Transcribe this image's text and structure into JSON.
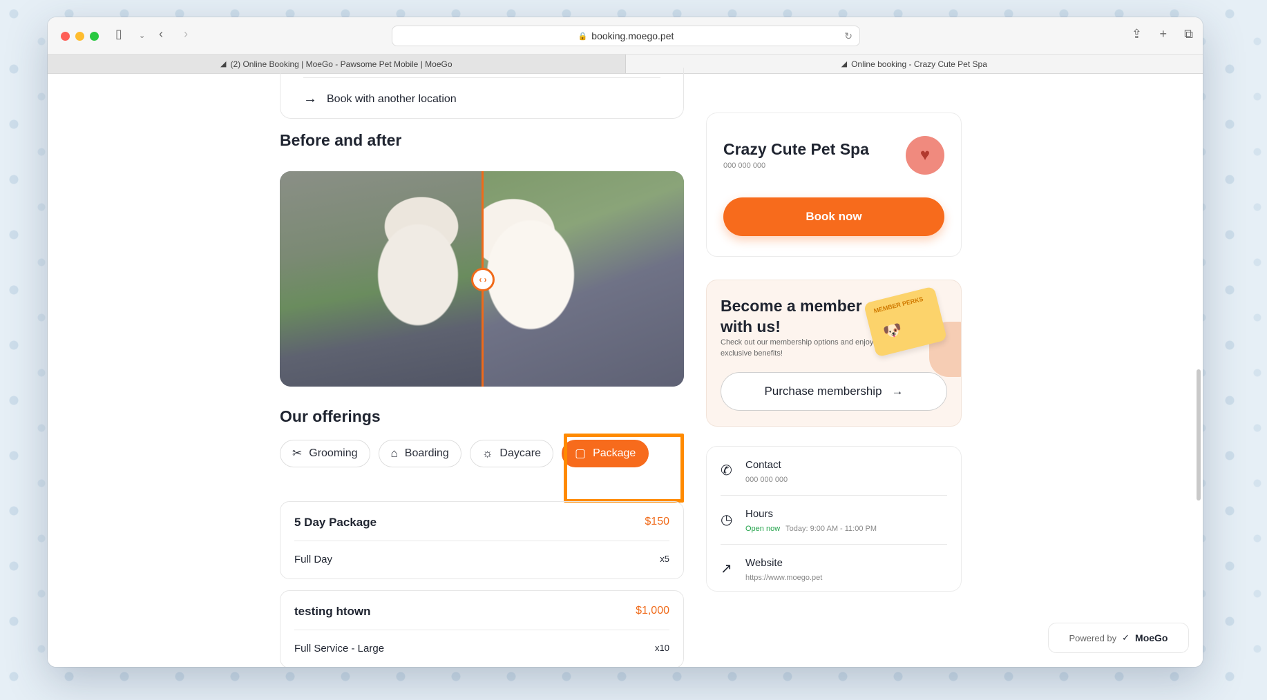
{
  "browser": {
    "url": "booking.moego.pet",
    "tabs": [
      {
        "label": "(2) Online Booking | MoeGo - Pawsome Pet Mobile | MoeGo",
        "active": false
      },
      {
        "label": "Online booking - Crazy Cute Pet Spa",
        "active": true
      }
    ]
  },
  "location": {
    "book_another": "Book with another location"
  },
  "before_after": {
    "title": "Before and after"
  },
  "offerings": {
    "title": "Our offerings",
    "tabs": [
      {
        "label": "Grooming",
        "icon": "scissors-icon",
        "active": false
      },
      {
        "label": "Boarding",
        "icon": "house-icon",
        "active": false
      },
      {
        "label": "Daycare",
        "icon": "sun-icon",
        "active": false
      },
      {
        "label": "Package",
        "icon": "bag-icon",
        "active": true
      }
    ]
  },
  "packages": [
    {
      "name": "5 Day Package",
      "price": "$150",
      "item": "Full Day",
      "qty": "x5"
    },
    {
      "name": "testing htown",
      "price": "$1,000",
      "item": "Full Service - Large",
      "qty": "x10"
    }
  ],
  "business": {
    "name": "Crazy Cute Pet Spa",
    "phone": "000 000 000",
    "book_label": "Book now"
  },
  "membership": {
    "title": "Become a member with us!",
    "subtitle": "Check out our membership options and enjoy exclusive benefits!",
    "card_text": "MEMBER PERKS",
    "button": "Purchase membership"
  },
  "info": {
    "contact_title": "Contact",
    "contact_value": "000 000 000",
    "hours_title": "Hours",
    "hours_status": "Open now",
    "hours_value": "Today: 9:00 AM - 11:00 PM",
    "website_title": "Website",
    "website_value": "https://www.moego.pet"
  },
  "footer": {
    "powered_by": "Powered by",
    "brand": "MoeGo"
  },
  "colors": {
    "accent": "#f76b1c",
    "highlight": "#ff8a00",
    "open_status": "#22a34a"
  }
}
